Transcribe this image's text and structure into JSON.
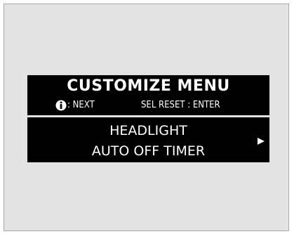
{
  "display": {
    "title": "CUSTOMIZE MENU",
    "hints": {
      "info_icon": "info-circle-icon",
      "next_label": ": NEXT",
      "reset_label": "SEL RESET : ENTER"
    },
    "item": {
      "line1": "HEADLIGHT",
      "line2": "AUTO OFF TIMER",
      "arrow_icon": "right-triangle-icon"
    }
  },
  "colors": {
    "screen_bg": "#000000",
    "text": "#ffffff",
    "frame_bg": "#e4e4e4"
  }
}
